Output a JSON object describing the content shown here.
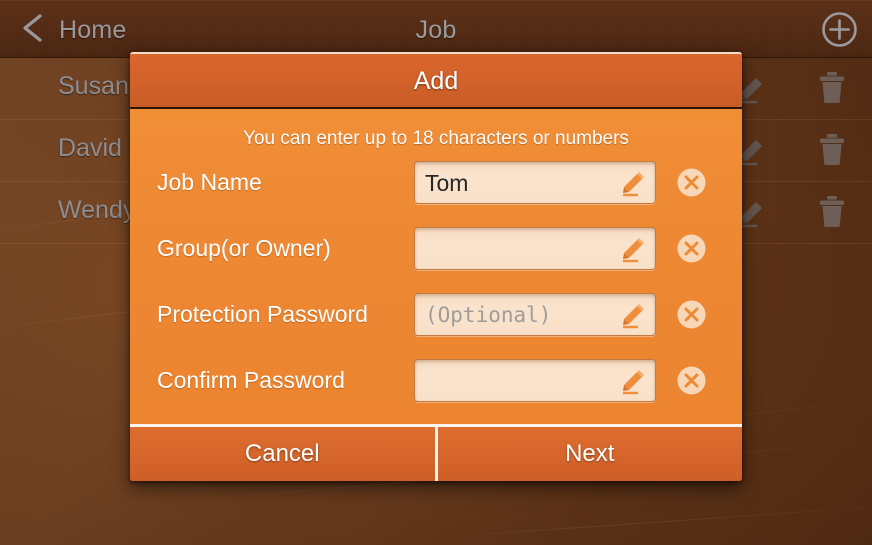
{
  "topbar": {
    "back_icon": "chevron-left-icon",
    "back_label": "Home",
    "title": "Job",
    "add_icon": "plus-circle-icon"
  },
  "background_list": {
    "rows": [
      {
        "name": "Susan",
        "edit_icon": "pencil-icon",
        "delete_icon": "trash-icon"
      },
      {
        "name": "David",
        "edit_icon": "pencil-icon",
        "delete_icon": "trash-icon"
      },
      {
        "name": "Wendy",
        "edit_icon": "pencil-icon",
        "delete_icon": "trash-icon"
      }
    ]
  },
  "dialog": {
    "title": "Add",
    "hint": "You can enter up to 18 characters or numbers",
    "fields": [
      {
        "label": "Job Name",
        "value": "Tom",
        "placeholder": "",
        "is_placeholder": false,
        "edit_icon": "pencil-icon",
        "clear_icon": "clear-circle-icon"
      },
      {
        "label": "Group(or Owner)",
        "value": "",
        "placeholder": "",
        "is_placeholder": false,
        "edit_icon": "pencil-icon",
        "clear_icon": "clear-circle-icon"
      },
      {
        "label": "Protection Password",
        "value": "",
        "placeholder": "(Optional)",
        "is_placeholder": true,
        "edit_icon": "pencil-icon",
        "clear_icon": "clear-circle-icon"
      },
      {
        "label": "Confirm Password",
        "value": "",
        "placeholder": "",
        "is_placeholder": false,
        "edit_icon": "pencil-icon",
        "clear_icon": "clear-circle-icon"
      }
    ],
    "cancel_label": "Cancel",
    "next_label": "Next"
  },
  "colors": {
    "dialog_body_orange": "#ED8733",
    "dialog_header_orange": "#D2612A",
    "footer_orange": "#D5652B",
    "field_cream": "#F9E0C8",
    "background_brown": "#5C3217",
    "topbar_brown": "#552C15",
    "muted_text": "#8D8D92",
    "white_text": "#FFFFFF"
  }
}
